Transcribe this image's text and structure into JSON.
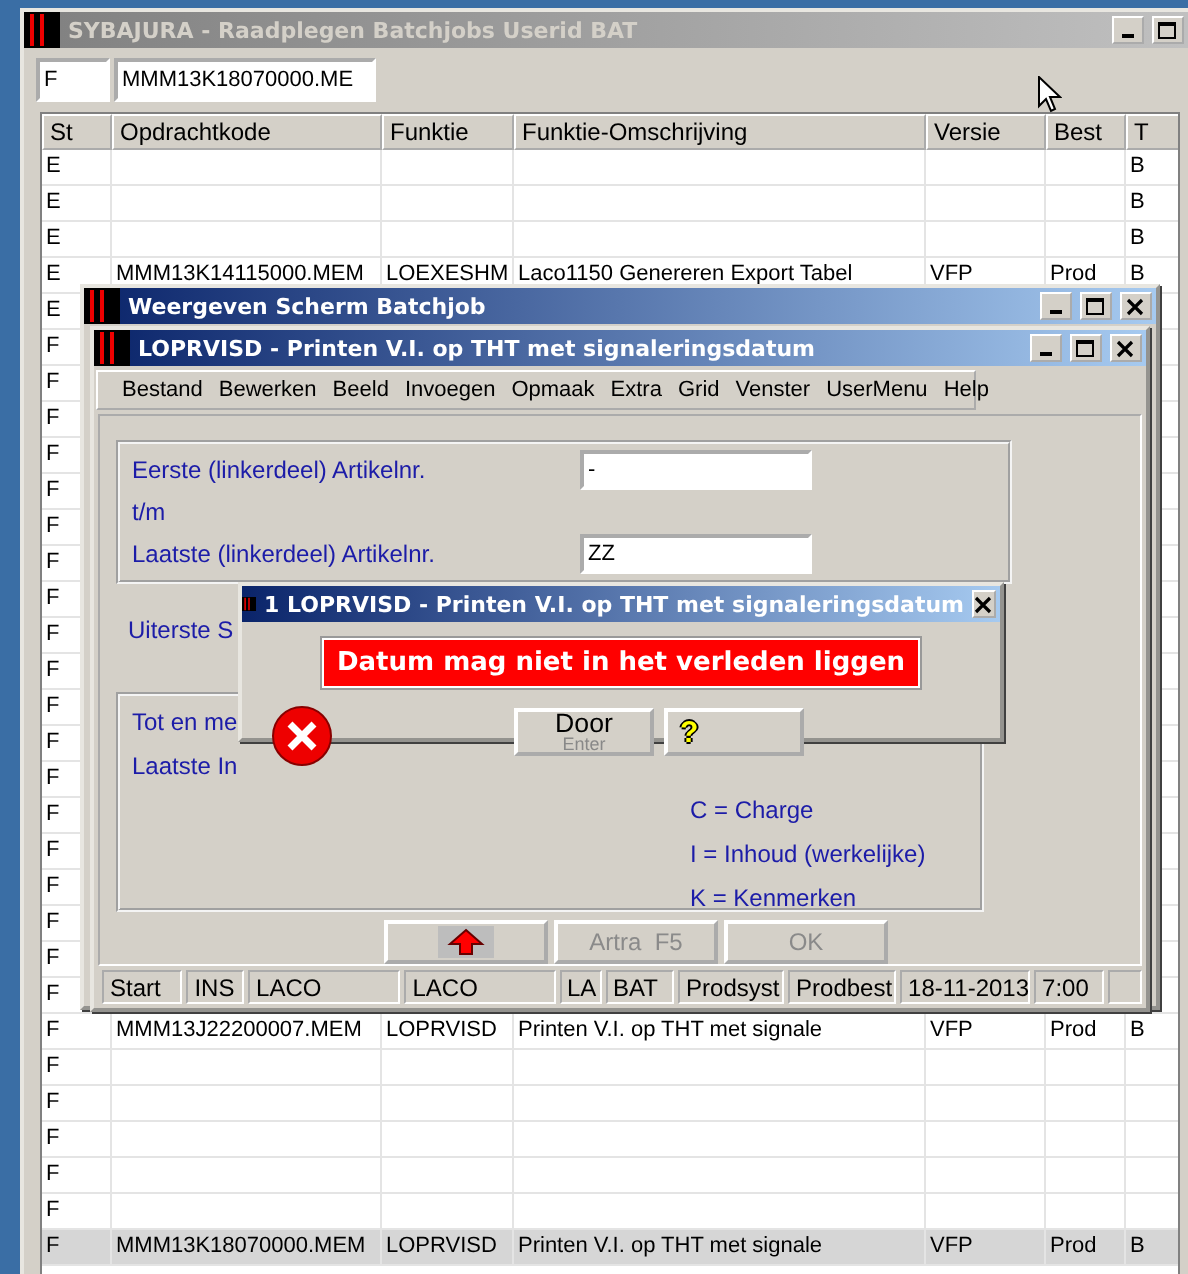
{
  "main_window": {
    "title": "SYBAJURA - Raadplegen Batchjobs Userid BAT",
    "active": false
  },
  "filters": [
    {
      "value": "F"
    },
    {
      "value": "MMM13K18070000.ME"
    }
  ],
  "table": {
    "columns": [
      "St",
      "Opdrachtkode",
      "Funktie",
      "Funktie-Omschrijving",
      "Versie",
      "Best",
      "T"
    ],
    "rows": [
      {
        "st": "E",
        "t": "B",
        "selected": false
      },
      {
        "st": "E",
        "t": "B",
        "selected": false
      },
      {
        "st": "E",
        "t": "B",
        "selected": false
      },
      {
        "st": "E",
        "code": "MMM13K14115000.MEM",
        "funktie": "LOEXESHM",
        "omschrijving": "Laco1150 Genereren Export Tabel",
        "versie": "VFP",
        "best": "Prod",
        "t": "B",
        "selected": false
      },
      {
        "st": "E",
        "selected": false
      },
      {
        "st": "F",
        "selected": false
      },
      {
        "st": "F",
        "selected": false
      },
      {
        "st": "F",
        "selected": false
      },
      {
        "st": "F",
        "selected": false
      },
      {
        "st": "F",
        "selected": false
      },
      {
        "st": "F",
        "selected": false
      },
      {
        "st": "F",
        "selected": false
      },
      {
        "st": "F",
        "selected": false
      },
      {
        "st": "F",
        "selected": false
      },
      {
        "st": "F",
        "selected": false
      },
      {
        "st": "F",
        "selected": false
      },
      {
        "st": "F",
        "selected": false
      },
      {
        "st": "F",
        "selected": false
      },
      {
        "st": "F",
        "selected": false
      },
      {
        "st": "F",
        "selected": false
      },
      {
        "st": "F",
        "selected": false
      },
      {
        "st": "F",
        "selected": false
      },
      {
        "st": "F",
        "selected": false
      },
      {
        "st": "F",
        "selected": false
      },
      {
        "st": "F",
        "code": "MMM13J22200007.MEM",
        "funktie": "LOPRVISD",
        "omschrijving": "Printen V.I. op THT met signale",
        "versie": "VFP",
        "best": "Prod",
        "t": "B",
        "selected": false
      },
      {
        "st": "F",
        "selected": false
      },
      {
        "st": "F",
        "selected": false
      },
      {
        "st": "F",
        "selected": false
      },
      {
        "st": "F",
        "selected": false
      },
      {
        "st": "F",
        "selected": false
      },
      {
        "st": "F",
        "code": "MMM13K18070000.MEM",
        "funktie": "LOPRVISD",
        "omschrijving": "Printen V.I. op THT met signale",
        "versie": "VFP",
        "best": "Prod",
        "t": "B",
        "selected": true
      }
    ]
  },
  "batch_window": {
    "title": "Weergeven Scherm Batchjob",
    "active": true
  },
  "form_window": {
    "title": "LOPRVISD - Printen V.I. op THT met signaleringsdatum",
    "active": true,
    "menu": [
      "Bestand",
      "Bewerken",
      "Beeld",
      "Invoegen",
      "Opmaak",
      "Extra",
      "Grid",
      "Venster",
      "UserMenu",
      "Help"
    ],
    "range_fields": [
      {
        "kind": "field",
        "label": "Eerste  (linkerdeel) Artikelnr.",
        "value": "-"
      },
      {
        "kind": "text",
        "label": "t/m"
      },
      {
        "kind": "field",
        "label": "Laatste (linkerdeel) Artikelnr.",
        "value": "ZZ"
      }
    ],
    "uiterste_label": "Uiterste S",
    "group_labels": [
      "Tot en me",
      "Laatste In"
    ],
    "legend": [
      "C = Charge",
      "I = Inhoud (werkelijke)",
      "K = Kenmerken"
    ],
    "buttons": [
      {
        "kind": "icon",
        "disabled": false
      },
      {
        "kind": "text",
        "label": "Artra  F5",
        "disabled": true
      },
      {
        "kind": "text",
        "label": "OK",
        "disabled": true
      }
    ],
    "status_bar": [
      "Start",
      "INS",
      "LACO",
      "LACO",
      "LA",
      "BAT",
      "Prodsyst",
      "Prodbest",
      "18-11-2013",
      "7:00"
    ]
  },
  "error_dialog": {
    "title": "1 LOPRVISD - Printen V.I. op THT met signaleringsdatum",
    "active": true,
    "message": "Datum mag niet in het verleden liggen",
    "buttons": [
      {
        "kind": "default",
        "label": "Door",
        "hint": "Enter"
      },
      {
        "kind": "help",
        "label": "?"
      }
    ]
  }
}
